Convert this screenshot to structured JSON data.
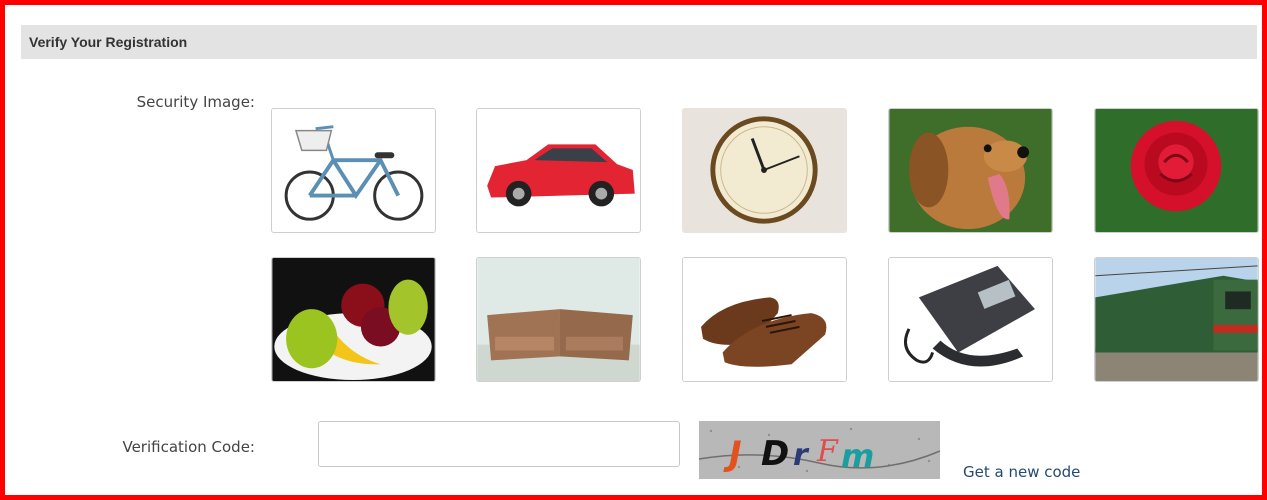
{
  "panel": {
    "title": "Verify Your Registration"
  },
  "form": {
    "security_label": "Security Image:",
    "code_label": "Verification Code:",
    "code_value": "",
    "new_code_link": "Get a new code"
  },
  "captcha": {
    "text": "JDrFm"
  },
  "security_images": [
    {
      "name": "bicycle"
    },
    {
      "name": "car"
    },
    {
      "name": "clock"
    },
    {
      "name": "dog"
    },
    {
      "name": "rose"
    },
    {
      "name": "fruit-bowl"
    },
    {
      "name": "sofa"
    },
    {
      "name": "shoes"
    },
    {
      "name": "telephone"
    },
    {
      "name": "train"
    }
  ],
  "colors": {
    "frame_border": "#ff0000",
    "header_bg": "#e3e3e3",
    "link": "#234a72"
  }
}
